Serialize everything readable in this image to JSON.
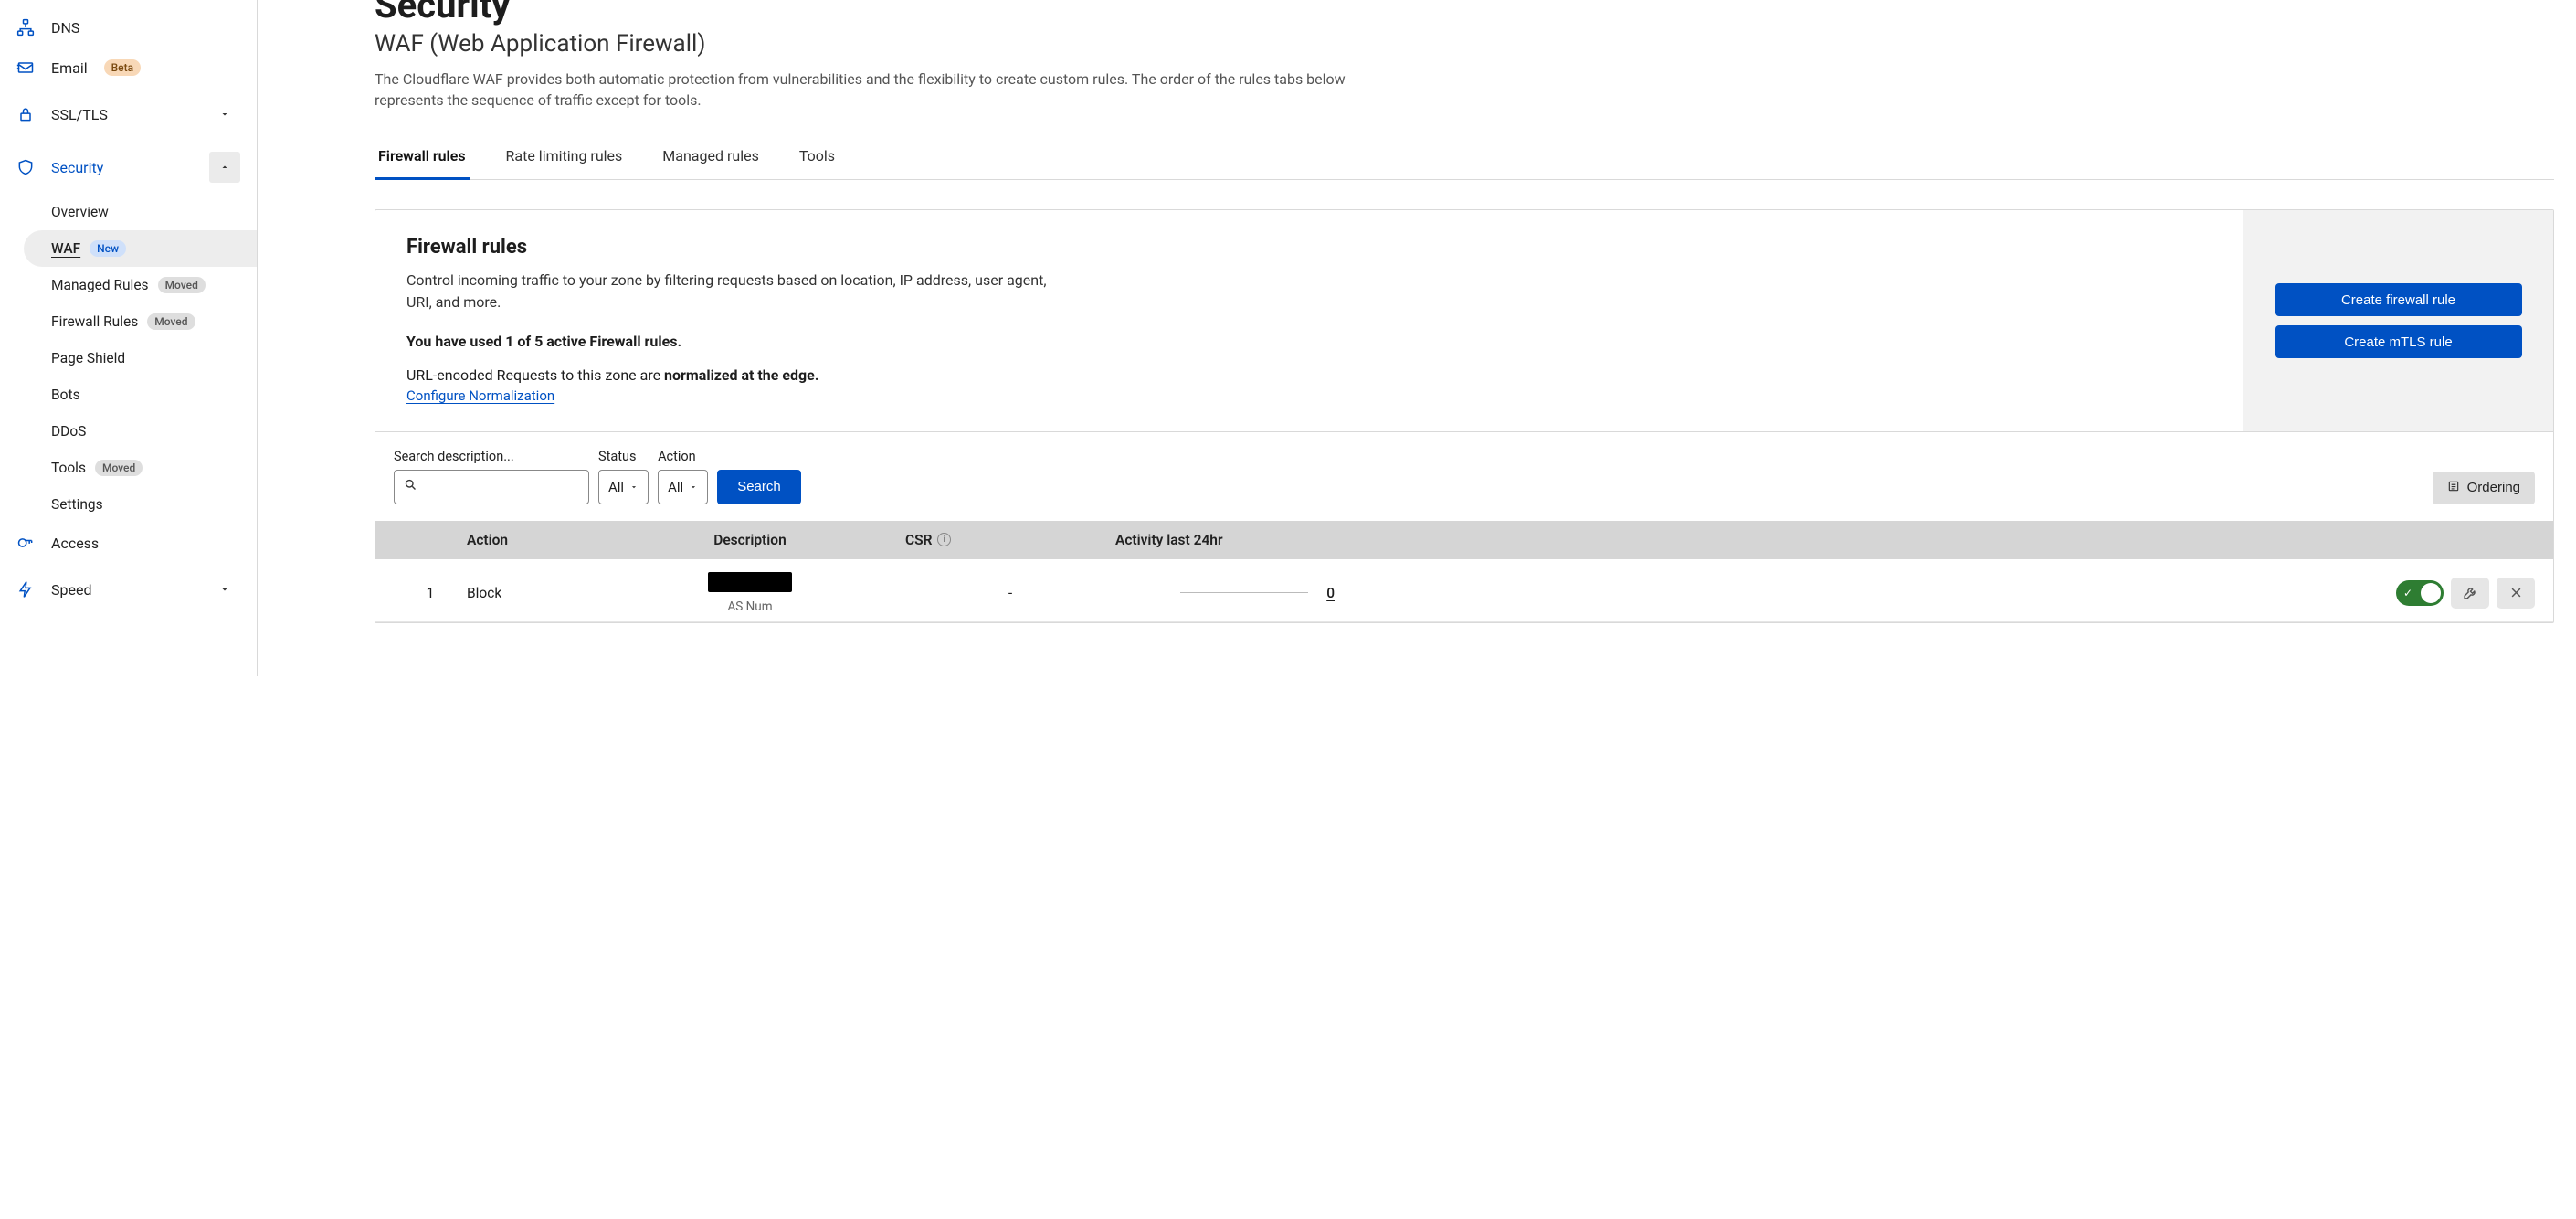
{
  "sidebar": {
    "items": [
      {
        "label": "DNS",
        "icon": "dns"
      },
      {
        "label": "Email",
        "icon": "email",
        "badge": "Beta",
        "badgeClass": "beta"
      },
      {
        "label": "SSL/TLS",
        "icon": "lock",
        "chevron": "down"
      },
      {
        "label": "Security",
        "icon": "shield",
        "chevron": "up",
        "expanded": true,
        "children": [
          {
            "label": "Overview"
          },
          {
            "label": "WAF",
            "active": true,
            "badge": "New",
            "badgeClass": "new"
          },
          {
            "label": "Managed Rules",
            "badge": "Moved",
            "badgeClass": "moved"
          },
          {
            "label": "Firewall Rules",
            "badge": "Moved",
            "badgeClass": "moved"
          },
          {
            "label": "Page Shield"
          },
          {
            "label": "Bots"
          },
          {
            "label": "DDoS"
          },
          {
            "label": "Tools",
            "badge": "Moved",
            "badgeClass": "moved"
          },
          {
            "label": "Settings"
          }
        ]
      },
      {
        "label": "Access",
        "icon": "access"
      },
      {
        "label": "Speed",
        "icon": "speed",
        "chevron": "down"
      }
    ]
  },
  "page": {
    "title": "Security",
    "subtitle": "WAF (Web Application Firewall)",
    "description": "The Cloudflare WAF provides both automatic protection from vulnerabilities and the flexibility to create custom rules. The order of the rules tabs below represents the sequence of traffic except for tools."
  },
  "tabs": [
    {
      "label": "Firewall rules",
      "active": true
    },
    {
      "label": "Rate limiting rules"
    },
    {
      "label": "Managed rules"
    },
    {
      "label": "Tools"
    }
  ],
  "panel": {
    "title": "Firewall rules",
    "subtitle": "Control incoming traffic to your zone by filtering requests based on location, IP address, user agent, URI, and more.",
    "usage": "You have used 1 of 5 active Firewall rules.",
    "norm_prefix": "URL-encoded Requests to this zone are ",
    "norm_bold": "normalized at the edge.",
    "config_link": "Configure Normalization",
    "create_rule": "Create firewall rule",
    "create_mtls": "Create mTLS rule"
  },
  "filters": {
    "search_label": "Search description...",
    "status_label": "Status",
    "action_label": "Action",
    "status_value": "All",
    "action_value": "All",
    "search_btn": "Search",
    "ordering_btn": "Ordering"
  },
  "table": {
    "headers": {
      "num": "",
      "action": "Action",
      "description": "Description",
      "csr": "CSR",
      "activity": "Activity last 24hr"
    },
    "rows": [
      {
        "num": "1",
        "action": "Block",
        "description_sub": "AS Num",
        "csr": "-",
        "activity": "0"
      }
    ]
  }
}
